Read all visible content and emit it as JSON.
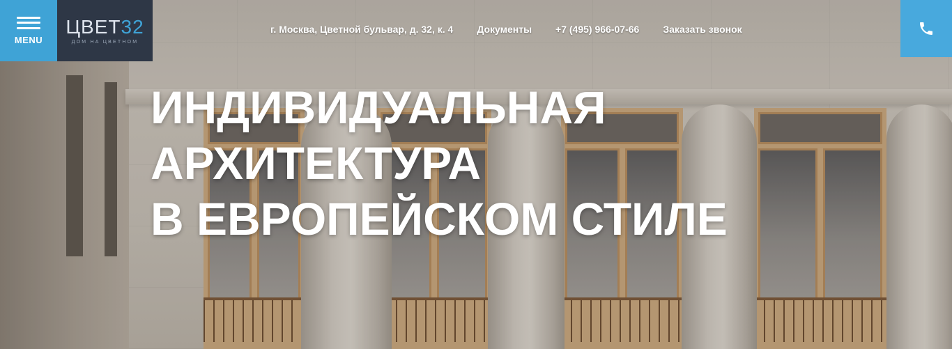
{
  "header": {
    "menu_label": "MENU",
    "logo_main": "ЦВЕТ",
    "logo_number": "32",
    "logo_sub": "дом на цветном",
    "nav": [
      {
        "label": "г. Москва, Цветной бульвар, д. 32, к. 4"
      },
      {
        "label": "Документы"
      },
      {
        "label": "+7 (495) 966-07-66"
      },
      {
        "label": "Заказать звонок"
      }
    ],
    "call_icon": "phone-icon",
    "menu_icon": "hamburger-icon"
  },
  "hero": {
    "lines": [
      "ИНДИВИДУАЛЬНАЯ",
      "АРХИТЕКТУРА",
      "В ЕВРОПЕЙСКОМ СТИЛЕ"
    ]
  },
  "colors": {
    "accent": "#3fa3d6",
    "logo_bg": "#2e3746",
    "text_light": "#ffffff"
  }
}
